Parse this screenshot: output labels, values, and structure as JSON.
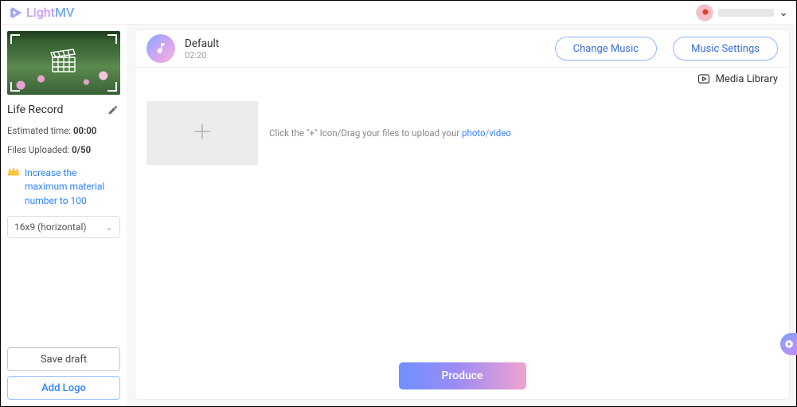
{
  "brand": {
    "name_light": "Light",
    "name_mv": "MV"
  },
  "sidebar": {
    "project_name": "Life Record",
    "estimated_time_label": "Estimated time:",
    "estimated_time_value": "00:00",
    "files_uploaded_label": "Files Uploaded:",
    "files_uploaded_value": "0/50",
    "upgrade_text": "Increase the maximum material number to 100",
    "aspect_ratio_selected": "16x9 (horizontal)",
    "save_draft_label": "Save draft",
    "add_logo_label": "Add Logo"
  },
  "music": {
    "title": "Default",
    "duration": "02:20",
    "change_label": "Change Music",
    "settings_label": "Music Settings"
  },
  "main": {
    "media_library_label": "Media Library",
    "upload_hint_pre": "Click the \"+\" Icon/Drag your files to upload your ",
    "upload_hint_link1": "photo",
    "upload_hint_sep": "/",
    "upload_hint_link2": "video",
    "produce_label": "Produce"
  }
}
